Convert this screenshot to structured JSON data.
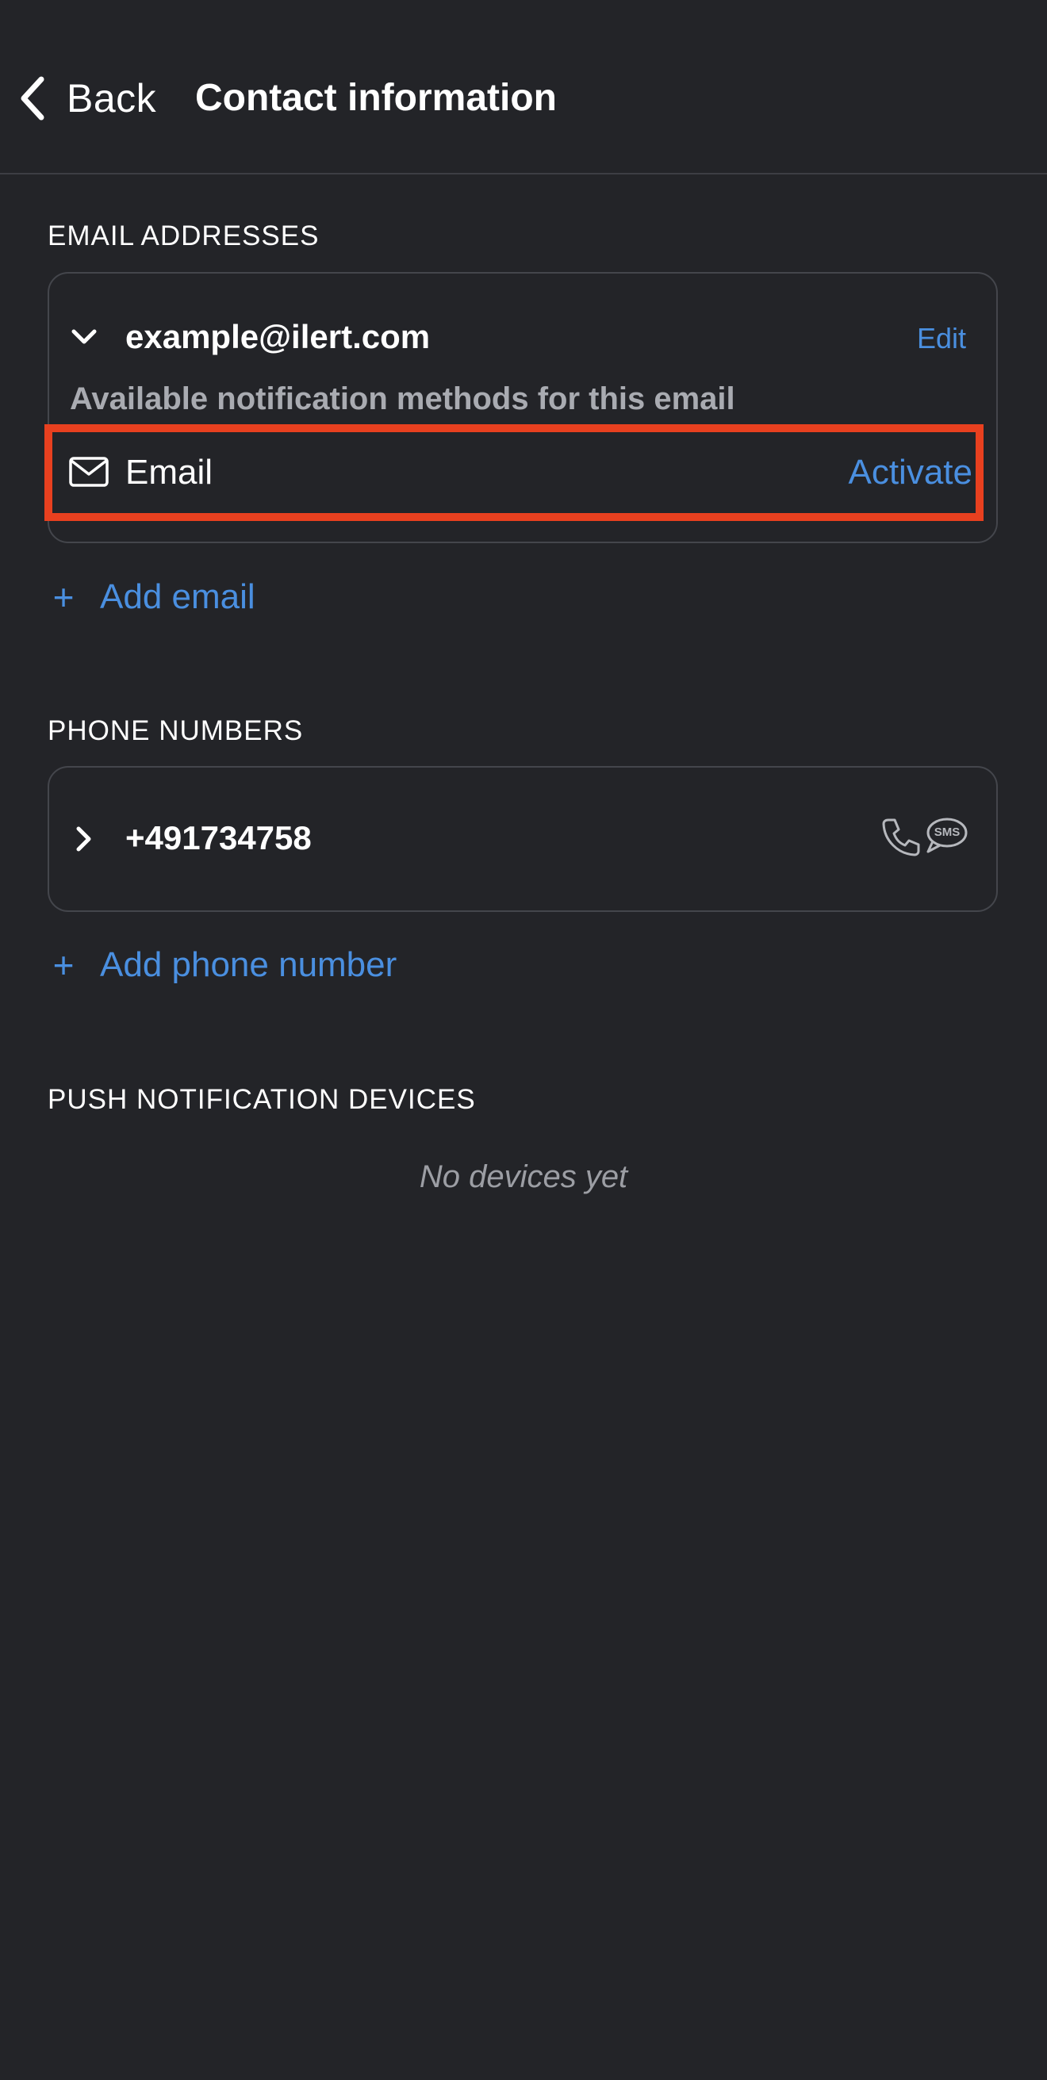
{
  "header": {
    "back_label": "Back",
    "title": "Contact information"
  },
  "emails": {
    "section_label": "EMAIL ADDRESSES",
    "items": [
      {
        "address": "example@ilert.com",
        "expanded": true,
        "edit_label": "Edit",
        "hint": "Available notification methods for this email",
        "methods": [
          {
            "icon": "envelope-icon",
            "label": "Email",
            "action_label": "Activate"
          }
        ]
      }
    ],
    "add_label": "Add email"
  },
  "phones": {
    "section_label": "PHONE NUMBERS",
    "items": [
      {
        "number": "+491734758",
        "expanded": false,
        "icons": [
          "phone-icon",
          "sms-icon"
        ],
        "sms_badge_text": "SMS"
      }
    ],
    "add_label": "Add phone number"
  },
  "push": {
    "section_label": "PUSH NOTIFICATION DEVICES",
    "empty_text": "No devices yet"
  },
  "colors": {
    "background": "#232428",
    "accent": "#4a8fe0",
    "highlight": "#e8401f",
    "card_border": "#44464c",
    "muted_text": "#a9abb1"
  },
  "icon_glyphs": {
    "plus": "+"
  }
}
